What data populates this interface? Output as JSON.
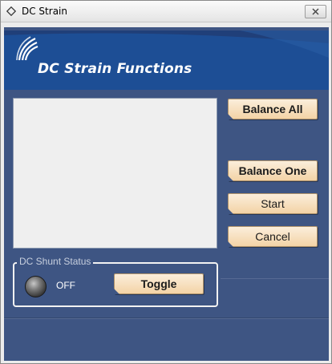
{
  "window": {
    "title": "DC Strain"
  },
  "banner": {
    "title": "DC Strain Functions"
  },
  "buttons": {
    "balance_all": "Balance All",
    "balance_one": "Balance One",
    "start": "Start",
    "cancel": "Cancel",
    "toggle": "Toggle"
  },
  "shunt": {
    "group_label": "DC Shunt Status",
    "status": "OFF"
  },
  "colors": {
    "panel_background": "#3e5583",
    "banner": "#1f4c8c",
    "button_gradient_top": "#fbeedb",
    "button_gradient_bottom": "#f3d3a6"
  },
  "icons": {
    "title_icon": "diamond-icon",
    "close": "close-icon",
    "logo": "swoosh-logo"
  }
}
